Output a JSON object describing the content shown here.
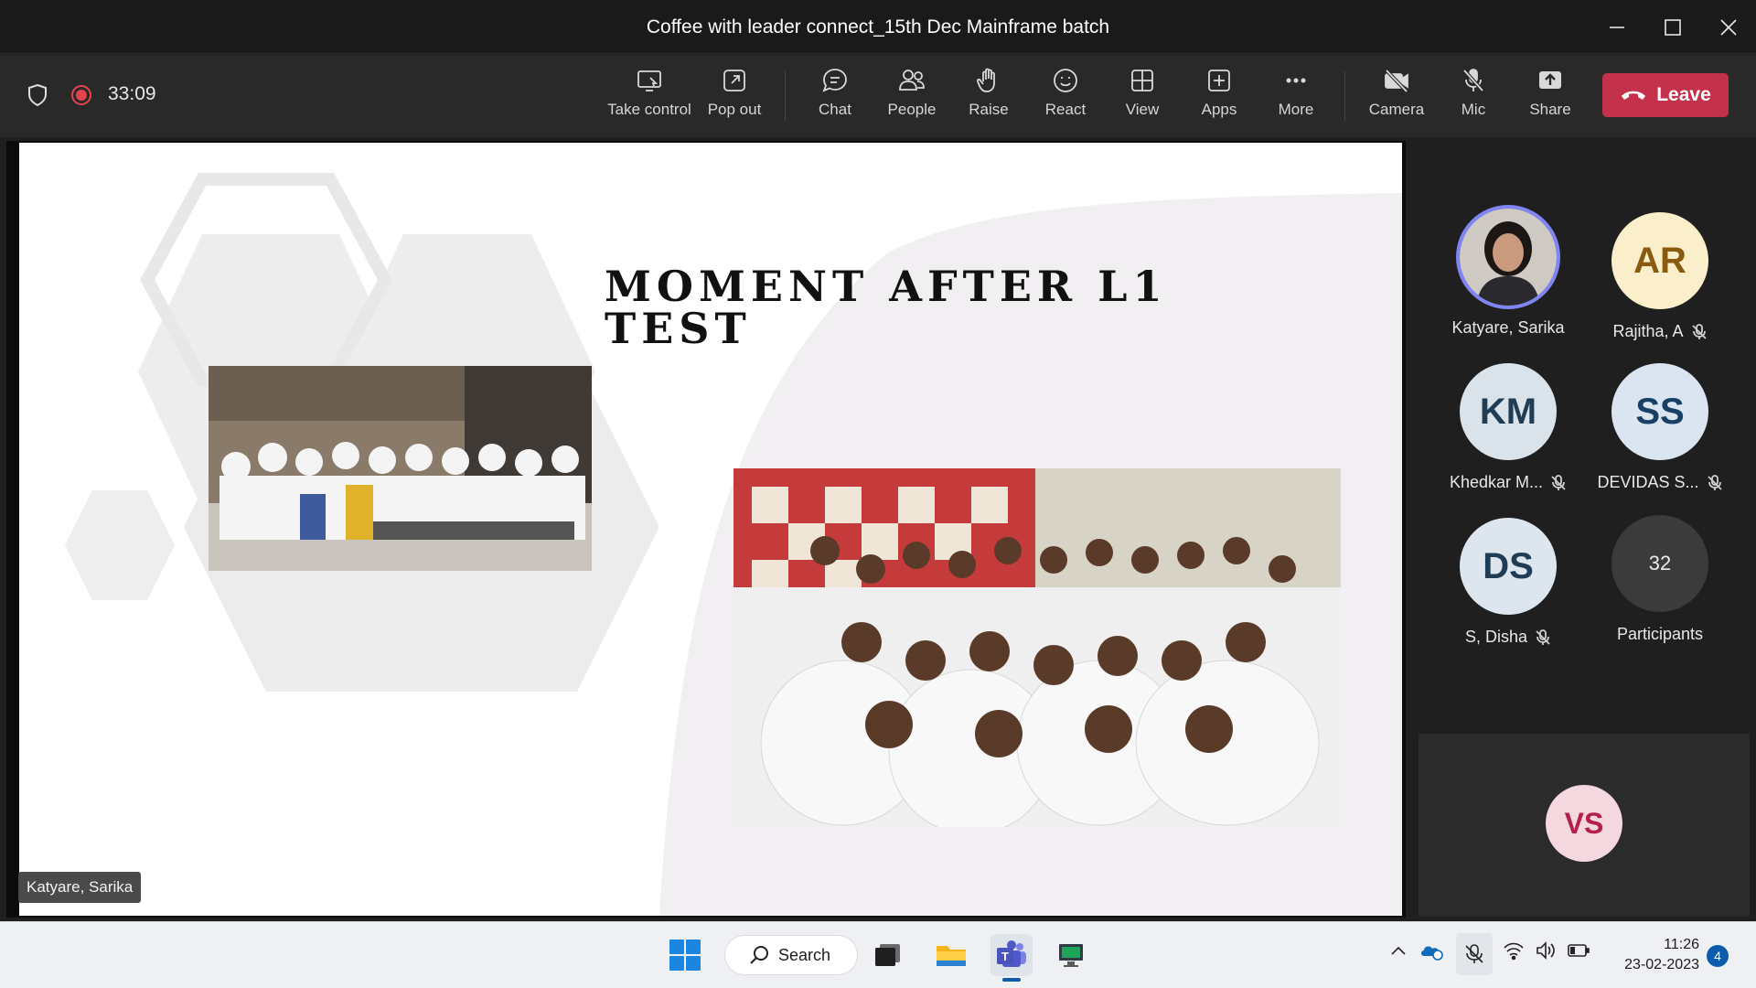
{
  "window": {
    "title": "Coffee with leader connect_15th Dec Mainframe batch"
  },
  "toolbar": {
    "timer": "33:09",
    "buttons": {
      "take_control": "Take control",
      "pop_out": "Pop out",
      "chat": "Chat",
      "people": "People",
      "raise": "Raise",
      "react": "React",
      "view": "View",
      "apps": "Apps",
      "more": "More",
      "camera": "Camera",
      "mic": "Mic",
      "share": "Share"
    },
    "leave_label": "Leave"
  },
  "slide": {
    "title": "Moment after L1 test"
  },
  "stage": {
    "speaker_name": "Katyare, Sarika"
  },
  "participants": {
    "tiles": [
      {
        "name": "Katyare, Sarika",
        "initials": "",
        "muted": false
      },
      {
        "name": "Rajitha, A",
        "initials": "AR",
        "muted": true
      },
      {
        "name": "Khedkar M...",
        "initials": "KM",
        "muted": true
      },
      {
        "name": "DEVIDAS S...",
        "initials": "SS",
        "muted": true
      },
      {
        "name": "S, Disha",
        "initials": "DS",
        "muted": true
      }
    ],
    "overflow_count": "32",
    "overflow_label": "Participants",
    "self_initials": "VS"
  },
  "taskbar": {
    "search_label": "Search",
    "time": "11:26",
    "date": "23-02-2023",
    "notification_count": "4"
  },
  "colors": {
    "leave": "#c4314b",
    "recording": "#e7434d",
    "speaker_ring": "#7f85f5"
  }
}
